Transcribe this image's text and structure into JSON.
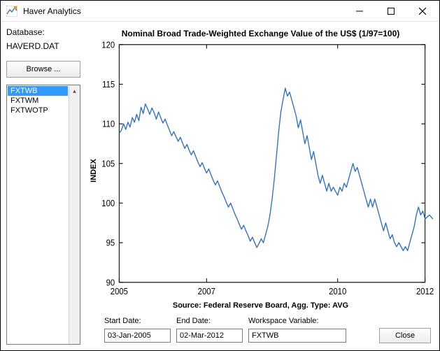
{
  "window": {
    "title": "Haver Analytics"
  },
  "database": {
    "label": "Database:",
    "value": "HAVERD.DAT"
  },
  "browse_label": "Browse ...",
  "series_list": {
    "items": [
      "FXTWB",
      "FXTWM",
      "FXTWOTP"
    ],
    "selected": "FXTWB"
  },
  "form": {
    "start_date_label": "Start Date:",
    "start_date_value": "03-Jan-2005",
    "end_date_label": "End Date:",
    "end_date_value": "02-Mar-2012",
    "workspace_label": "Workspace Variable:",
    "workspace_value": "FXTWB",
    "close_label": "Close"
  },
  "chart_data": {
    "type": "line",
    "title": "Nominal Broad Trade-Weighted Exchange Value of the US$ (1/97=100)",
    "ylabel": "INDEX",
    "xlabel": "Source: Federal Reserve Board,  Agg. Type: AVG",
    "xlim": [
      2005,
      2012
    ],
    "ylim": [
      90,
      120
    ],
    "xticks": [
      2005,
      2007,
      2010,
      2012
    ],
    "yticks": [
      90,
      95,
      100,
      105,
      110,
      115,
      120
    ],
    "series": [
      {
        "name": "FXTWB",
        "color": "#2f6fc2",
        "x": [
          2005.0,
          2005.05,
          2005.1,
          2005.15,
          2005.2,
          2005.25,
          2005.3,
          2005.35,
          2005.4,
          2005.45,
          2005.5,
          2005.55,
          2005.6,
          2005.65,
          2005.7,
          2005.75,
          2005.8,
          2005.85,
          2005.9,
          2005.95,
          2006.0,
          2006.05,
          2006.1,
          2006.15,
          2006.2,
          2006.25,
          2006.3,
          2006.35,
          2006.4,
          2006.45,
          2006.5,
          2006.55,
          2006.6,
          2006.65,
          2006.7,
          2006.75,
          2006.8,
          2006.85,
          2006.9,
          2006.95,
          2007.0,
          2007.05,
          2007.1,
          2007.15,
          2007.2,
          2007.25,
          2007.3,
          2007.35,
          2007.4,
          2007.45,
          2007.5,
          2007.55,
          2007.6,
          2007.65,
          2007.7,
          2007.75,
          2007.8,
          2007.85,
          2007.9,
          2007.95,
          2008.0,
          2008.05,
          2008.1,
          2008.15,
          2008.2,
          2008.25,
          2008.3,
          2008.35,
          2008.4,
          2008.45,
          2008.5,
          2008.55,
          2008.6,
          2008.65,
          2008.7,
          2008.75,
          2008.8,
          2008.85,
          2008.9,
          2008.95,
          2009.0,
          2009.05,
          2009.1,
          2009.15,
          2009.2,
          2009.25,
          2009.3,
          2009.35,
          2009.4,
          2009.45,
          2009.5,
          2009.55,
          2009.6,
          2009.65,
          2009.7,
          2009.75,
          2009.8,
          2009.85,
          2009.9,
          2009.95,
          2010.0,
          2010.05,
          2010.1,
          2010.15,
          2010.2,
          2010.25,
          2010.3,
          2010.35,
          2010.4,
          2010.45,
          2010.5,
          2010.55,
          2010.6,
          2010.65,
          2010.7,
          2010.75,
          2010.8,
          2010.85,
          2010.9,
          2010.95,
          2011.0,
          2011.05,
          2011.1,
          2011.15,
          2011.2,
          2011.25,
          2011.3,
          2011.35,
          2011.4,
          2011.45,
          2011.5,
          2011.55,
          2011.6,
          2011.65,
          2011.7,
          2011.75,
          2011.8,
          2011.85,
          2011.9,
          2011.95,
          2012.0,
          2012.1,
          2012.18
        ],
        "values": [
          108.8,
          109.2,
          110.0,
          109.3,
          110.2,
          109.6,
          110.8,
          110.2,
          111.2,
          110.4,
          112.1,
          111.3,
          112.5,
          111.9,
          111.2,
          112.0,
          111.4,
          110.6,
          111.5,
          110.8,
          110.1,
          110.6,
          109.9,
          109.2,
          108.5,
          109.0,
          108.4,
          107.8,
          108.3,
          107.6,
          106.9,
          107.4,
          106.7,
          106.1,
          106.6,
          105.9,
          105.2,
          104.6,
          105.1,
          104.4,
          103.8,
          104.3,
          103.6,
          102.9,
          102.3,
          102.8,
          102.1,
          101.4,
          100.8,
          100.1,
          99.5,
          100.0,
          99.3,
          98.6,
          98.0,
          97.3,
          96.7,
          97.2,
          96.5,
          95.9,
          95.2,
          95.7,
          95.0,
          94.4,
          94.9,
          95.5,
          95.0,
          96.0,
          97.0,
          98.5,
          100.5,
          103.0,
          106.0,
          109.0,
          111.5,
          113.0,
          114.5,
          113.5,
          114.0,
          113.0,
          112.0,
          111.0,
          109.5,
          110.5,
          109.0,
          107.5,
          108.5,
          107.0,
          105.5,
          106.5,
          105.0,
          103.5,
          102.5,
          103.5,
          102.5,
          101.5,
          102.5,
          101.5,
          102.0,
          101.5,
          101.0,
          102.0,
          101.5,
          102.5,
          102.0,
          103.0,
          104.0,
          105.0,
          104.0,
          104.5,
          103.5,
          102.5,
          101.5,
          100.5,
          99.5,
          100.5,
          99.5,
          100.5,
          99.5,
          98.5,
          97.5,
          96.5,
          97.5,
          96.5,
          95.5,
          96.0,
          95.0,
          94.5,
          95.0,
          94.5,
          94.0,
          94.5,
          94.0,
          95.0,
          96.0,
          97.0,
          98.5,
          99.5,
          98.5,
          99.0,
          98.0,
          98.5,
          98.0
        ]
      }
    ]
  }
}
